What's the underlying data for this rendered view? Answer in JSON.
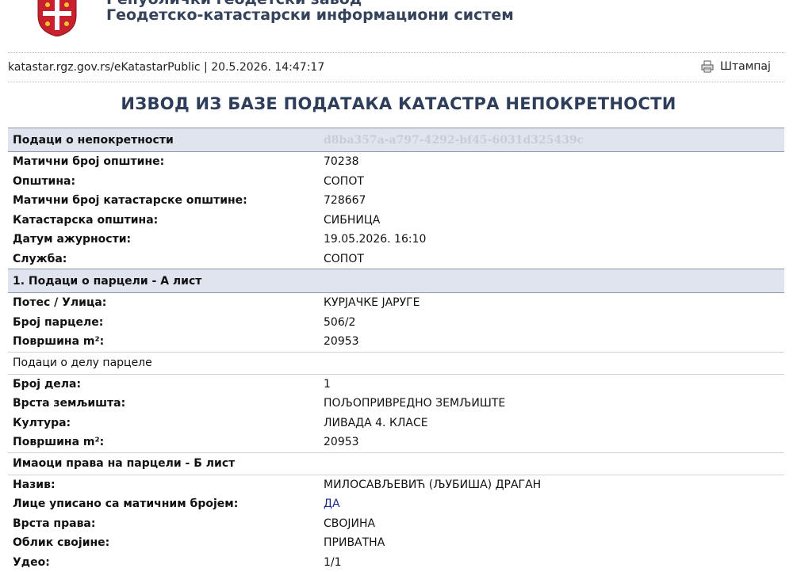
{
  "header": {
    "org_line1": "Републички геодетски завод",
    "org_line2": "Геодетско-катастарски информациони систем",
    "meta": "katastar.rgz.gov.rs/eKatastarPublic | 20.5.2026. 14:47:17",
    "print_label": "Штампај",
    "print_icon": "printer-icon",
    "crest_icon": "serbian-coat-of-arms-icon"
  },
  "title": "ИЗВОД ИЗ БАЗЕ ПОДАТАКА КАТАСТРА НЕПОКРЕТНОСТИ",
  "property": {
    "section": "Подаци о непокретности",
    "guid": "d8ba357a-a797-4292-bf45-6031d325439c",
    "rows": [
      {
        "k": "Матични број општине:",
        "v": "70238"
      },
      {
        "k": "Општина:",
        "v": "СОПОТ"
      },
      {
        "k": "Матични број катастарске општине:",
        "v": "728667"
      },
      {
        "k": "Катастарска општина:",
        "v": "СИБНИЦА"
      },
      {
        "k": "Датум ажурности:",
        "v": "19.05.2026. 16:10"
      },
      {
        "k": "Служба:",
        "v": "СОПОТ"
      }
    ]
  },
  "parcel": {
    "section": "1. Подаци о парцели - А лист",
    "rows": [
      {
        "k": "Потес / Улица:",
        "v": "КУРЈАЧКЕ ЈАРУГЕ"
      },
      {
        "k": "Број парцеле:",
        "v": "506/2"
      },
      {
        "k": "Површина m²:",
        "v": "20953"
      }
    ]
  },
  "part": {
    "section": "Подаци о делу парцеле",
    "rows": [
      {
        "k": "Број дела:",
        "v": "1"
      },
      {
        "k": "Врста земљишта:",
        "v": "ПОЉОПРИВРЕДНО ЗЕМЉИШТЕ"
      },
      {
        "k": "Култура:",
        "v": "ЛИВАДА 4. КЛАСЕ"
      },
      {
        "k": "Површина m²:",
        "v": "20953"
      }
    ]
  },
  "owners": {
    "section": "Имаоци права на парцели - Б лист",
    "rows": [
      {
        "k": "Назив:",
        "v": "МИЛОСАВЉЕВИЋ (ЉУБИША) ДРАГАН"
      },
      {
        "k": "Лице уписано са матичним бројем:",
        "v": "ДА"
      },
      {
        "k": "Врста права:",
        "v": "СВОЈИНА"
      },
      {
        "k": "Облик својине:",
        "v": "ПРИВАТНА"
      },
      {
        "k": "Удео:",
        "v": "1/1"
      }
    ]
  },
  "colors": {
    "title": "#2e3e5a",
    "section_bg": "#dfe4ef",
    "yes_text": "#1a2a8a",
    "guid_text": "#c8ccd4"
  }
}
